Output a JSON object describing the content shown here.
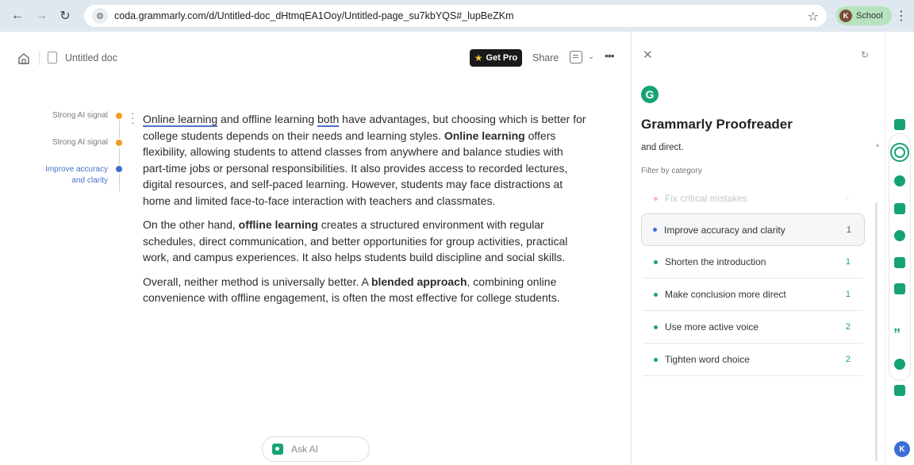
{
  "browser": {
    "url": "coda.grammarly.com/d/Untitled-doc_dHtmqEA1Ooy/Untitled-page_su7kbYQS#_lupBeZKm",
    "profile_label": "School",
    "profile_initial": "K"
  },
  "header": {
    "doc_title": "Untitled doc",
    "get_pro_label": "Get Pro",
    "share_label": "Share"
  },
  "signals": [
    {
      "label": "Strong AI signal",
      "color": "#f39c25"
    },
    {
      "label": "Strong AI signal",
      "color": "#f39c25"
    },
    {
      "label": "Improve accuracy and clarity",
      "color": "#3b6fd4"
    }
  ],
  "document": {
    "p1_a": "Online learning",
    "p1_b": " and offline learning ",
    "p1_c": "both",
    "p1_d": " have advantages, but choosing which is better for college students depends on their needs and learning styles. ",
    "p1_e": "Online learning",
    "p1_f": " offers flexibility, allowing students to attend classes from anywhere and balance studies with part-time jobs or personal responsibilities. It also provides access to recorded lectures, digital resources, and self-paced learning. However, students may face distractions at home and limited face-to-face interaction with teachers and classmates.",
    "p2_a": "On the other hand, ",
    "p2_b": "offline learning",
    "p2_c": " creates a structured environment with regular schedules, direct communication, and better opportunities for group activities, practical work, and campus experiences. It also helps students build discipline and social skills.",
    "p3_a": "Overall, neither method is universally better. A ",
    "p3_b": "blended approach",
    "p3_c": ", combining online convenience with offline engagement, is often the most effective for college students."
  },
  "ask_ai": {
    "label": "Ask AI"
  },
  "panel": {
    "title": "Grammarly Proofreader",
    "subtitle": "and direct.",
    "filter_label": "Filter by category",
    "categories": [
      {
        "label": "Fix critical mistakes",
        "count": "✓"
      },
      {
        "label": "Improve accuracy and clarity",
        "count": "1"
      },
      {
        "label": "Shorten the introduction",
        "count": "1"
      },
      {
        "label": "Make conclusion more direct",
        "count": "1"
      },
      {
        "label": "Use more active voice",
        "count": "2"
      },
      {
        "label": "Tighten word choice",
        "count": "2"
      }
    ]
  },
  "user": {
    "initial": "K"
  },
  "colors": {
    "grammarly_green": "#15a372",
    "accent_blue": "#3b6fd4",
    "signal_orange": "#f39c25"
  }
}
